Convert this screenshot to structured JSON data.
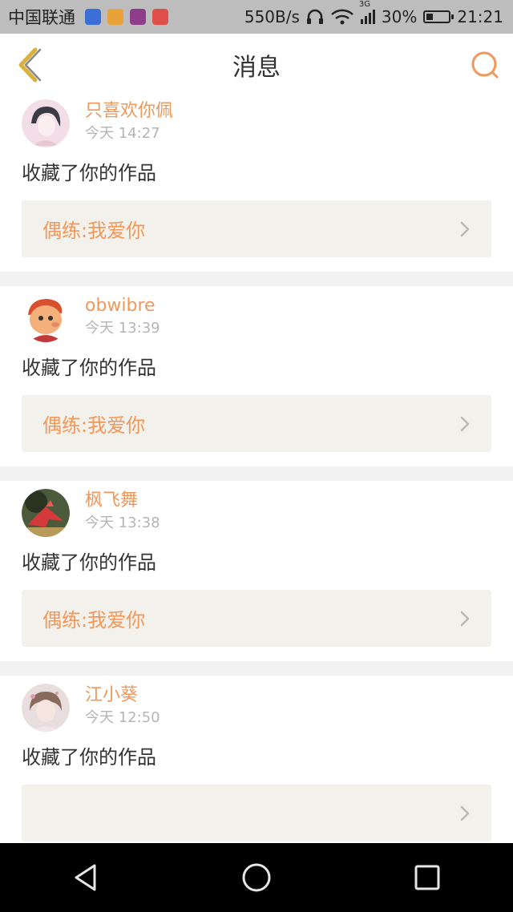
{
  "status_bar": {
    "carrier": "中国联通",
    "speed": "550B/s",
    "network": "3G",
    "battery": "30%",
    "battery_level": 0.3,
    "time": "21:21",
    "app_icon_colors": [
      "#3a6fd8",
      "#e8a23a",
      "#8e3d8a",
      "#e0504a"
    ]
  },
  "header": {
    "title": "消息"
  },
  "colors": {
    "accent": "#f0975a",
    "back_arrow": "#d9b23b"
  },
  "messages": [
    {
      "user": "只喜欢你佩",
      "time": "今天 14:27",
      "action": "收藏了你的作品",
      "work": "偶练:我爱你",
      "avatar": "avatar-girl-sketch"
    },
    {
      "user": "obwibre",
      "time": "今天 13:39",
      "action": "收藏了你的作品",
      "work": "偶练:我爱你",
      "avatar": "avatar-cartoon-face"
    },
    {
      "user": "枫飞舞",
      "time": "今天 13:38",
      "action": "收藏了你的作品",
      "work": "偶练:我爱你",
      "avatar": "avatar-paper-crane"
    },
    {
      "user": "江小葵",
      "time": "今天 12:50",
      "action": "收藏了你的作品",
      "work": "",
      "avatar": "avatar-girl-photo"
    }
  ]
}
